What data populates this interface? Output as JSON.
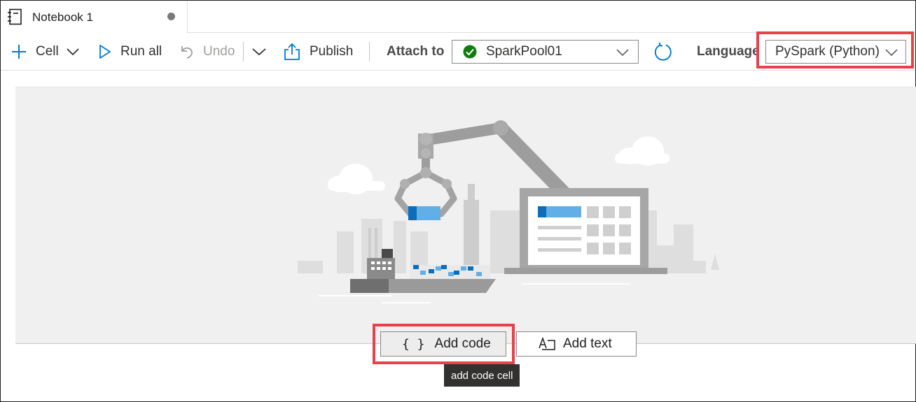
{
  "tab": {
    "title": "Notebook 1",
    "icon": "notebook-icon",
    "modified_indicator": "unsaved-dot"
  },
  "toolbar": {
    "cell_label": "Cell",
    "run_all_label": "Run all",
    "undo_label": "Undo",
    "publish_label": "Publish",
    "attach_to_label": "Attach to",
    "attach_to_value": "SparkPool01",
    "attach_status": "connected",
    "language_label": "Language",
    "language_value": "PySpark (Python)"
  },
  "actions": {
    "add_code_label": "Add code",
    "add_code_icon": "{ }",
    "add_text_label": "Add text",
    "tooltip": "add code cell"
  },
  "colors": {
    "accent": "#0078d4",
    "status_ok": "#107c10",
    "highlight": "#e8414b"
  }
}
